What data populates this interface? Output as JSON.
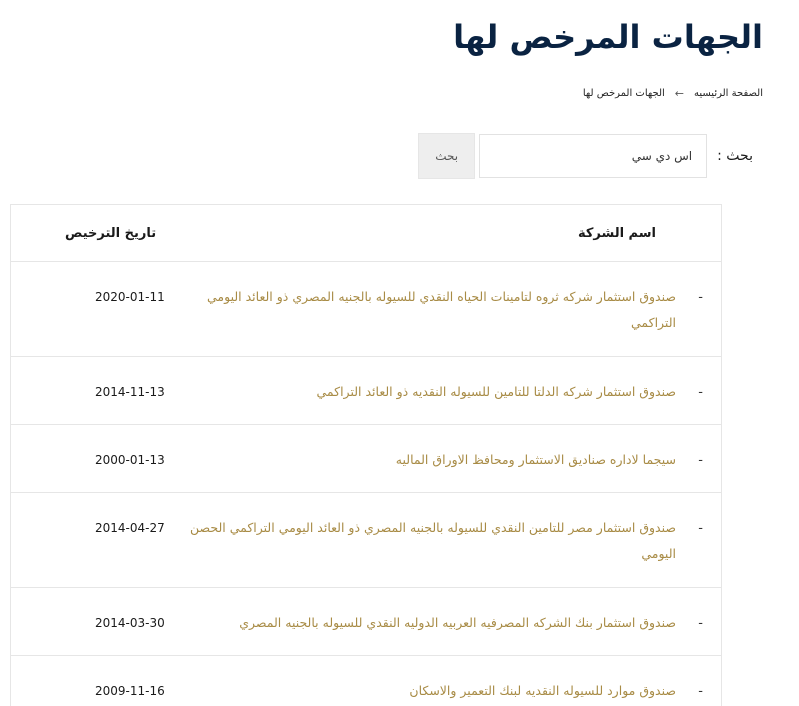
{
  "page": {
    "title": "الجهات المرخص لها"
  },
  "breadcrumb": {
    "home": "الصفحة الرئيسيه",
    "separator": "←",
    "current": "الجهات المرخص لها"
  },
  "search": {
    "label": "بحث :",
    "value": "اس دي سي",
    "button_label": "بحث"
  },
  "table": {
    "columns": {
      "company": "اسم الشركة",
      "license_date": "تاريخ الترخيص"
    },
    "row_marker": "-",
    "rows": [
      {
        "name": "صندوق استثمار شركه ثروه لتامينات الحياه النقدي للسيوله بالجنيه المصري ذو العائد اليومي التراكمي",
        "date": "2020-01-11"
      },
      {
        "name": "صندوق استثمار شركه الدلتا للتامين للسيوله النقديه ذو العائد التراكمي",
        "date": "2014-11-13"
      },
      {
        "name": "سيجما لاداره صناديق الاستثمار ومحافظ الاوراق الماليه",
        "date": "2000-01-13"
      },
      {
        "name": "صندوق استثمار مصر للتامين النقدي للسيوله بالجنيه المصري ذو العائد اليومي التراكمي الحصن اليومي",
        "date": "2014-04-27"
      },
      {
        "name": "صندوق استثمار بنك الشركه المصرفيه العربيه الدوليه النقدي للسيوله بالجنيه المصري",
        "date": "2014-03-30"
      },
      {
        "name": "صندوق موارد للسيوله النقديه لبنك التعمير والاسكان",
        "date": "2009-11-16"
      }
    ]
  },
  "colors": {
    "title": "#0a2342",
    "link": "#a88b45",
    "border": "#e6e6e6",
    "button_bg": "#eeeeee"
  }
}
